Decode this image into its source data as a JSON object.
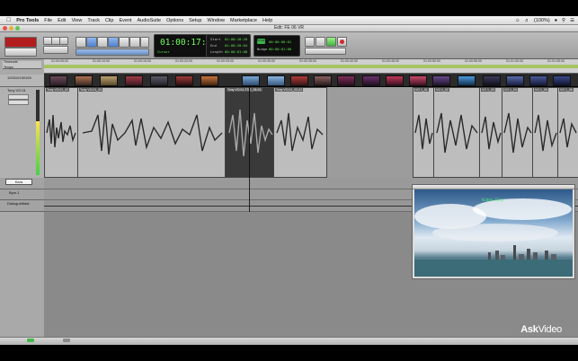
{
  "menu": {
    "app": "Pro Tools",
    "items": [
      "File",
      "Edit",
      "View",
      "Track",
      "Clip",
      "Event",
      "AudioSuite",
      "Options",
      "Setup",
      "Window",
      "Marketplace",
      "Help"
    ],
    "status_battery": "(100%)"
  },
  "window": {
    "title": "Edit: FE 06 VR"
  },
  "toolbar": {
    "main_counter": "01:00:17:12",
    "main_counter_mode": "Cursor",
    "counter_labels": [
      "Start",
      "End",
      "Length"
    ],
    "counter_values": [
      "01:00:18:20",
      "01:00:20:04",
      "00:00:01:08"
    ],
    "grid_label": "Grid",
    "nudge_label": "Nudge",
    "grid_value": "00:00:00:01",
    "nudge_value": "00:00:01:00"
  },
  "tracks": {
    "video_track": "120310190105",
    "audio_track": "Tony VO.01",
    "audio_sub": "Tony VO.01",
    "labels": [
      "Kara",
      "Bym.1",
      "DialogueMast"
    ]
  },
  "timeline": {
    "timecode_label": "Timecode",
    "tempo_label": "Tempo",
    "ticks": [
      "01:00:05:00",
      "01:00:10:00",
      "01:00:15:00",
      "01:00:20:00",
      "01:00:25:00",
      "01:00:30:00",
      "01:00:35:00",
      "01:00:40:00",
      "01:00:45:00",
      "01:00:50:00",
      "01:00:55:00",
      "01:01:00:00",
      "01:01:05:00"
    ]
  },
  "clips": [
    {
      "name": "Tony VO.01_02"
    },
    {
      "name": "Tony VO.01_03"
    },
    {
      "name": "Tony VO.01-TSG_05-01"
    },
    {
      "name": "Tony VO.01_03-02"
    },
    {
      "name": "VO 1_01"
    },
    {
      "name": "VO 1_02"
    },
    {
      "name": "VO 1_03"
    },
    {
      "name": "VO 1_04"
    },
    {
      "name": "VO 1_05"
    },
    {
      "name": "VO 1_06"
    }
  ],
  "video_window": {
    "label": "Video Clip"
  },
  "watermark": {
    "brand": "Ask",
    "brand2": "Video"
  }
}
